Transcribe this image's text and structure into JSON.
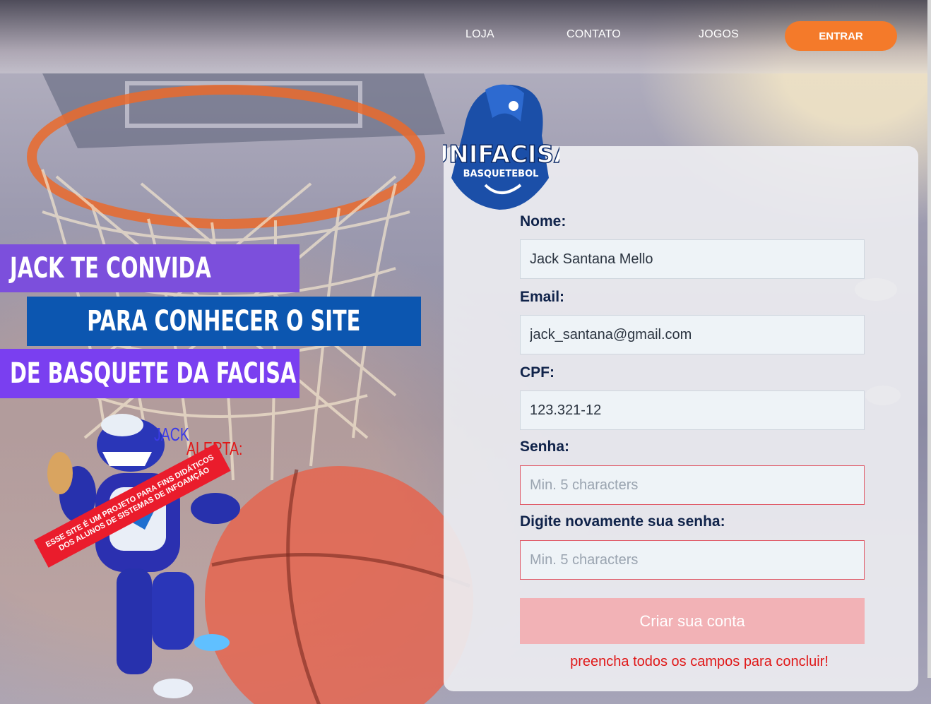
{
  "nav": {
    "links": [
      "LOJA",
      "CONTATO",
      "JOGOS"
    ],
    "enter": "ENTRAR"
  },
  "banner": {
    "line1": "JACK TE CONVIDA",
    "line2": "PARA CONHECER O SITE",
    "line3": "DE BASQUETE DA FACISA"
  },
  "alert": {
    "jack": "JACK",
    "alerta": "ALERTA:",
    "ribbon_line1": "ESSE SITE É UM PROJETO PARA FINS DIDÁTICOS",
    "ribbon_line2": "DOS ALUNOS DE SISTEMAS DE INFOAMÇÃO"
  },
  "logo": {
    "main_text": "UNIFACISA",
    "sub_text": "BASQUETEBOL"
  },
  "form": {
    "name_label": "Nome:",
    "name_value": "Jack Santana Mello",
    "email_label": "Email:",
    "email_value": "jack_santana@gmail.com",
    "cpf_label": "CPF:",
    "cpf_value": "123.321-12",
    "password_label": "Senha:",
    "password_placeholder": "Min. 5 characters",
    "confirm_label": "Digite novamente sua senha:",
    "confirm_placeholder": "Min. 5 characters",
    "submit_label": "Criar sua conta",
    "warning": "preencha todos os campos para concluir!"
  },
  "colors": {
    "accent_orange": "#f47a2a",
    "banner_purple": "#7c4fdc",
    "banner_blue": "#0c56b0",
    "error_red": "#e01818",
    "label_navy": "#10234a"
  }
}
